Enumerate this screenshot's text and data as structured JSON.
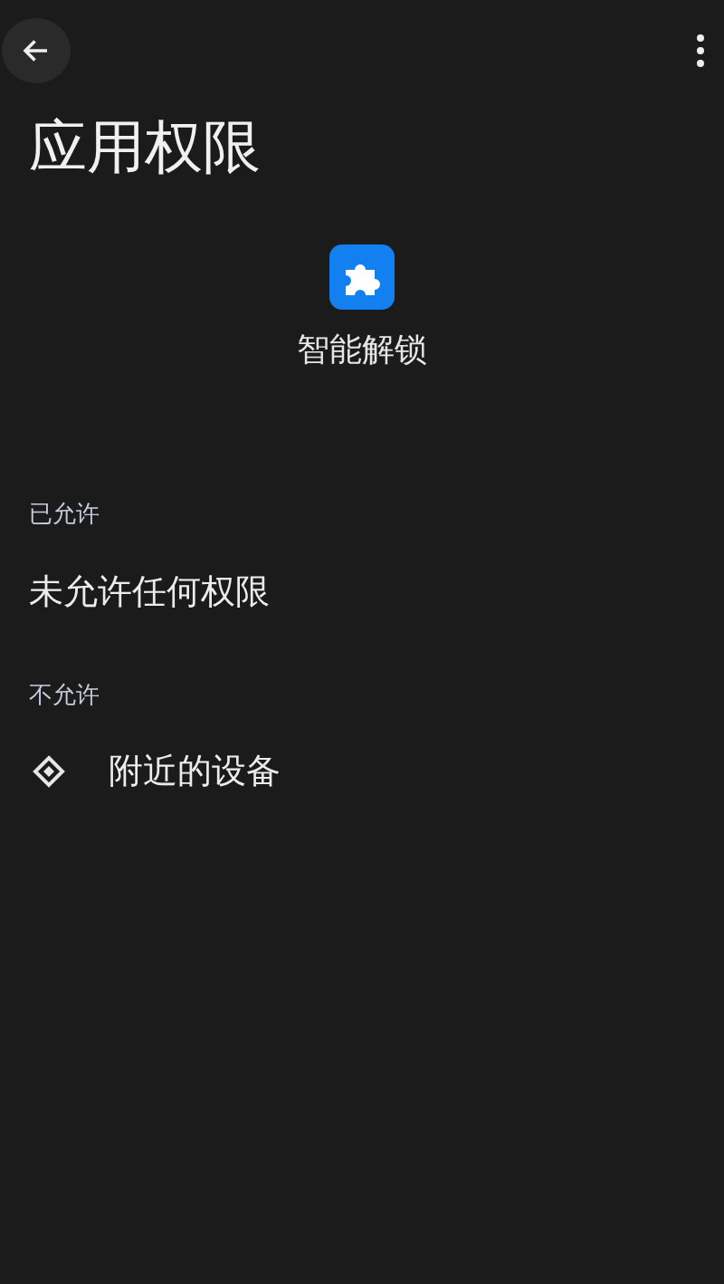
{
  "title": "应用权限",
  "app": {
    "name": "智能解锁"
  },
  "sections": [
    {
      "header": "已允许",
      "items": [
        {
          "kind": "message",
          "label": "未允许任何权限"
        }
      ]
    },
    {
      "header": "不允许",
      "items": [
        {
          "kind": "permission",
          "label": "附近的设备"
        }
      ]
    }
  ]
}
